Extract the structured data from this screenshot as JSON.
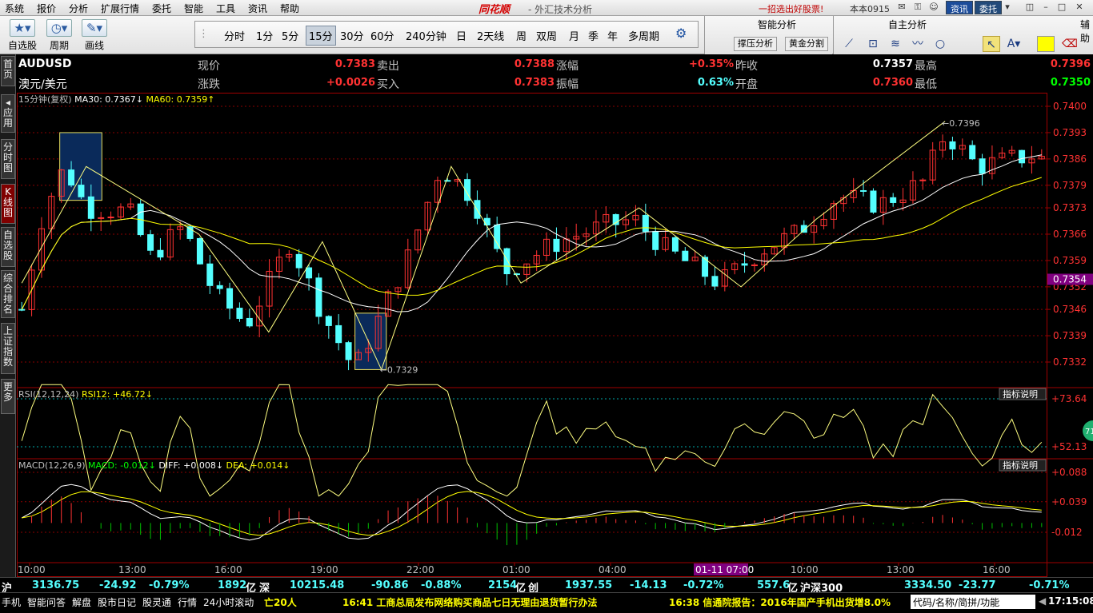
{
  "menu": {
    "items": [
      "系统",
      "报价",
      "分析",
      "扩展行情",
      "委托",
      "智能",
      "工具",
      "资讯",
      "帮助"
    ],
    "brand": "同花顺",
    "window_title": "- 外汇技术分析",
    "promo": "一招选出好股票!",
    "user": "本本0915",
    "btn_news": "资讯",
    "btn_trade": "委托"
  },
  "toolbar": {
    "tools": [
      {
        "label": "自选股",
        "icon": "star-icon"
      },
      {
        "label": "周期",
        "icon": "clock-icon"
      },
      {
        "label": "画线",
        "icon": "pen-icon"
      }
    ],
    "periods": [
      "分时",
      "1分",
      "5分",
      "15分",
      "30分",
      "60分",
      "240分钟",
      "日",
      "2天线",
      "周",
      "双周",
      "月",
      "季",
      "年",
      "多周期"
    ],
    "selected_period": "15分"
  },
  "smart_panel": {
    "title": "智能分析",
    "btn1": "撑压分析",
    "btn2": "黄金分割"
  },
  "self_panel": {
    "title": "自主分析",
    "side": "辅助"
  },
  "left_tabs": [
    "首页",
    "应用",
    "分时图",
    "K线图",
    "自选股",
    "综合排名",
    "上证指数",
    "更多"
  ],
  "quote": {
    "code": "AUDUSD",
    "name": "澳元/美元",
    "labels": [
      "现价",
      "涨跌",
      "卖出",
      "买入",
      "涨幅",
      "振幅",
      "昨收",
      "开盘",
      "最高",
      "最低"
    ],
    "current": "0.7383",
    "change": "+0.0026",
    "sell": "0.7388",
    "buy": "0.7383",
    "pct": "+0.35%",
    "amplitude": "0.63%",
    "prev_close": "0.7357",
    "open": "0.7360",
    "high": "0.7396",
    "low": "0.7350"
  },
  "kline": {
    "title": "15分钟(复权)",
    "ma30_label": "MA30:",
    "ma30": "0.7367",
    "ma60_label": "MA60:",
    "ma60": "0.7359",
    "axis": [
      "0.7400",
      "0.7393",
      "0.7386",
      "0.7379",
      "0.7373",
      "0.7366",
      "0.7359",
      "0.7352",
      "0.7346",
      "0.7339",
      "0.7332"
    ],
    "current_tag": "0.7354",
    "high_mark": "0.7396",
    "low_mark": "0.7329"
  },
  "rsi": {
    "label": "RSI(12,12,24)",
    "value_label": "RSI12:",
    "value": "+46.72",
    "help": "指标说明",
    "axis": [
      "+73.64",
      "+52.13"
    ],
    "badge": "71"
  },
  "macd": {
    "label": "MACD(12,26,9)",
    "macd_label": "MACD:",
    "macd": "-0.012",
    "diff_label": "DIFF:",
    "diff": "+0.008",
    "dea_label": "DEA:",
    "dea": "+0.014",
    "help": "指标说明",
    "axis": [
      "+0.088",
      "+0.039",
      "-0.012"
    ]
  },
  "time_axis": [
    "10:00",
    "13:00",
    "16:00",
    "19:00",
    "22:00",
    "01:00",
    "04:00",
    "01-11 07:00",
    "10:00",
    "13:00",
    "16:00"
  ],
  "index_bar": {
    "sh_label": "沪",
    "sh_val": "3136.75",
    "sh_chg": "-24.92",
    "sh_pct": "-0.79%",
    "sh_amt": "1892",
    "unit": "亿",
    "sz_label": "深",
    "sz_val": "10215.48",
    "sz_chg": "-90.86",
    "sz_pct": "-0.88%",
    "sz_amt": "2154",
    "cy_label": "创",
    "cy_val": "1937.55",
    "cy_chg": "-14.13",
    "cy_pct": "-0.72%",
    "cy_amt": "557.6",
    "hs_label": "沪深300",
    "hs_val": "3334.50",
    "hs_chg": "-23.77",
    "hs_pct": "-0.71%"
  },
  "bottom": {
    "items": [
      "手机",
      "智能问答",
      "解盘",
      "股市日记",
      "股灵通",
      "行情",
      "24小时滚动"
    ],
    "alert": "亡20人",
    "news1": "16:41 工商总局发布网络购买商品七日无理由退货暂行办法",
    "news2": "16:38 信通院报告：2016年国产手机出货增8.0%",
    "search_placeholder": "代码/名称/简拼/功能",
    "clock": "17:15:08"
  },
  "colors": {
    "up": "#ff3232",
    "down": "#54ffff",
    "ma30": "#ffffff",
    "ma60": "#ffff00",
    "text_yellow": "#ffff00",
    "grid": "#8b0000"
  }
}
